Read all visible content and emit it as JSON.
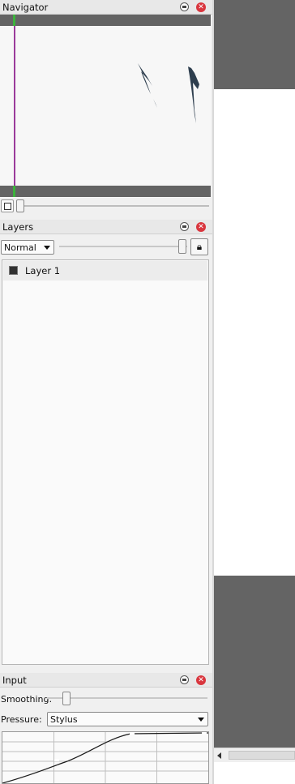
{
  "navigator": {
    "title": "Navigator"
  },
  "layers": {
    "title": "Layers",
    "blend_mode": "Normal",
    "opacity_percent": 100,
    "items": [
      {
        "name": "Layer 1"
      }
    ]
  },
  "input": {
    "title": "Input",
    "smoothing_label": "Smoothing:",
    "pressure_label": "Pressure:",
    "pressure_value": "Stylus"
  },
  "colors": {
    "panel_bg": "#f0f0f0",
    "canvas_grey": "#646464",
    "nav_view_line": "#9b3b9b",
    "nav_view_marker": "#3bb33b",
    "close_button": "#d9363e",
    "stroke": "#2e3e4e"
  }
}
